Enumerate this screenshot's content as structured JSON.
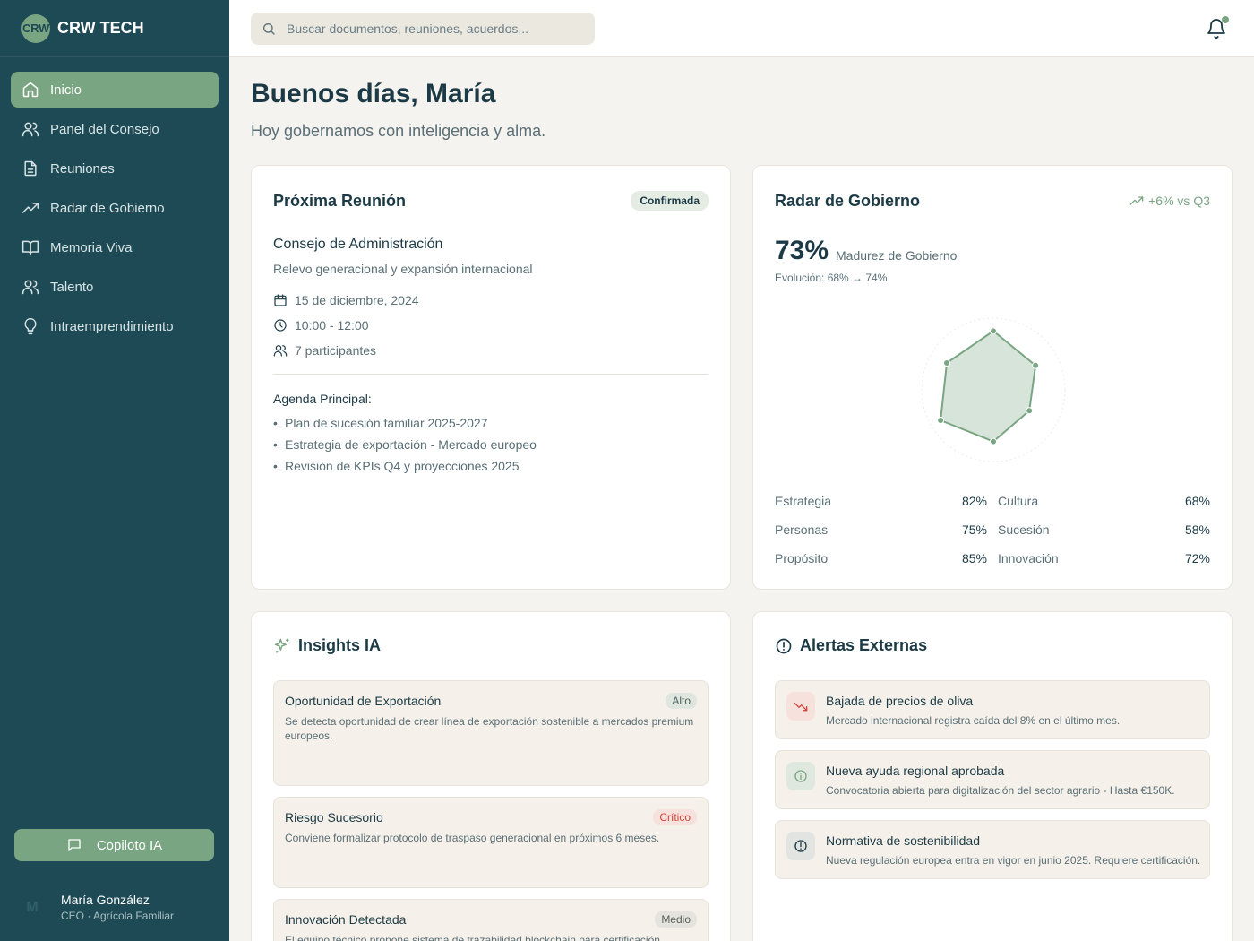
{
  "brand": {
    "logo": "CRW",
    "name": "CRW TECH"
  },
  "nav": [
    {
      "label": "Inicio",
      "icon": "home-icon"
    },
    {
      "label": "Panel del Consejo",
      "icon": "users-icon"
    },
    {
      "label": "Reuniones",
      "icon": "document-icon"
    },
    {
      "label": "Radar de Gobierno",
      "icon": "trend-icon"
    },
    {
      "label": "Memoria Viva",
      "icon": "book-icon"
    },
    {
      "label": "Talento",
      "icon": "users-icon"
    },
    {
      "label": "Intraemprendimiento",
      "icon": "lightbulb-icon"
    }
  ],
  "copilot": {
    "label": "Copiloto IA"
  },
  "user": {
    "initial": "M",
    "name": "María González",
    "role": "CEO · Agrícola Familiar"
  },
  "search": {
    "placeholder": "Buscar documentos, reuniones, acuerdos..."
  },
  "header": {
    "greeting": "Buenos días, María",
    "subtitle": "Hoy gobernamos con inteligencia y alma."
  },
  "meeting": {
    "title": "Próxima Reunión",
    "status": "Confirmada",
    "name": "Consejo de Administración",
    "description": "Relevo generacional y expansión internacional",
    "date": "15 de diciembre, 2024",
    "time": "10:00 - 12:00",
    "participants": "7 participantes",
    "agenda_title": "Agenda Principal:",
    "agenda": [
      "Plan de sucesión familiar 2025-2027",
      "Estrategia de exportación - Mercado europeo",
      "Revisión de KPIs Q4 y proyecciones 2025"
    ]
  },
  "radar": {
    "title": "Radar de Gobierno",
    "trend": "+6% vs Q3",
    "percent": "73%",
    "percent_label": "Madurez de Gobierno",
    "evolution": "Evolución: 68% → 74%",
    "metrics": [
      {
        "label": "Estrategia",
        "value": "82%"
      },
      {
        "label": "Cultura",
        "value": "68%"
      },
      {
        "label": "Personas",
        "value": "75%"
      },
      {
        "label": "Sucesión",
        "value": "58%"
      },
      {
        "label": "Propósito",
        "value": "85%"
      },
      {
        "label": "Innovación",
        "value": "72%"
      }
    ]
  },
  "insights": {
    "title": "Insights IA",
    "items": [
      {
        "title": "Oportunidad de Exportación",
        "tag": "Alto",
        "text": "Se detecta oportunidad de crear línea de exportación sostenible a mercados premium europeos."
      },
      {
        "title": "Riesgo Sucesorio",
        "tag": "Crítico",
        "text": "Conviene formalizar protocolo de traspaso generacional en próximos 6 meses."
      },
      {
        "title": "Innovación Detectada",
        "tag": "Medio",
        "text": "El equipo técnico propone sistema de trazabilidad blockchain para certificación orgánica."
      }
    ]
  },
  "alerts": {
    "title": "Alertas Externas",
    "items": [
      {
        "title": "Bajada de precios de oliva",
        "text": "Mercado internacional registra caída del 8% en el último mes.",
        "icon": "trend-down-icon"
      },
      {
        "title": "Nueva ayuda regional aprobada",
        "text": "Convocatoria abierta para digitalización del sector agrario - Hasta €150K.",
        "icon": "info-icon"
      },
      {
        "title": "Normativa de sostenibilidad",
        "text": "Nueva regulación europea entra en vigor en junio 2025. Requiere certificación.",
        "icon": "alert-icon"
      }
    ]
  },
  "colors": {
    "sidebar": "#1e4a55",
    "accent": "#7aa583",
    "critical": "#d0453b",
    "background": "#f5f3ef"
  }
}
